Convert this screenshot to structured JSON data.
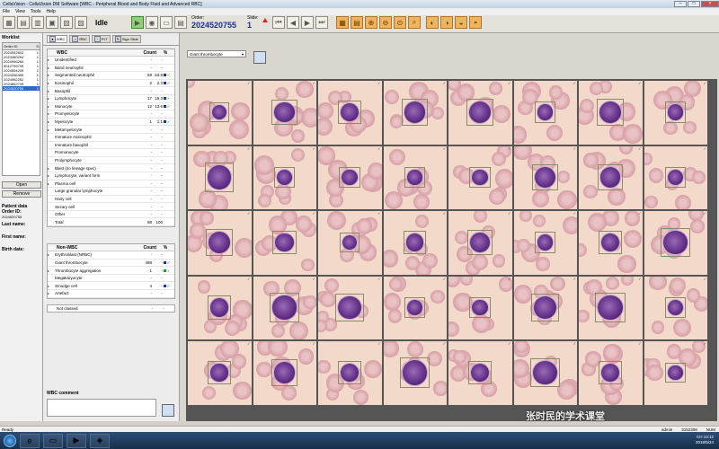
{
  "window": {
    "title": "CellaVision - CellaVision DM Software [WBC - Peripheral Blood and Body Fluid and Advanced RBC]"
  },
  "menu": [
    "File",
    "View",
    "Tools",
    "Help"
  ],
  "toolbar": {
    "status": "Idle",
    "order_label": "Order:",
    "order_value": "2024520755",
    "slide_label": "Slide:",
    "slide_value": "1"
  },
  "worklist": {
    "title": "Worklist",
    "columns": [
      "Order ID",
      "S"
    ],
    "rows": [
      {
        "id": "2024052602",
        "s": "1"
      },
      {
        "id": "2024460294",
        "s": "1"
      },
      {
        "id": "2024946260",
        "s": "1"
      },
      {
        "id": "9012799739",
        "s": "1"
      },
      {
        "id": "2024554209",
        "s": "1"
      },
      {
        "id": "2024346459",
        "s": "1"
      },
      {
        "id": "2024962252",
        "s": "1"
      },
      {
        "id": "2024662749",
        "s": "1"
      },
      {
        "id": "2024520755",
        "s": "1"
      }
    ],
    "open_label": "Open",
    "remove_label": "Remove"
  },
  "patient": {
    "title": "Patient data",
    "order_label": "Order ID:",
    "order_value": "2024520755",
    "last_label": "Last name:",
    "first_label": "First name:",
    "birth_label": "Birth date:"
  },
  "tabs": [
    {
      "label": "WBC"
    },
    {
      "label": "RBC"
    },
    {
      "label": "PLT"
    },
    {
      "label": "Sign Slide"
    }
  ],
  "wbc_table": {
    "header": {
      "name": "WBC",
      "count": "Count",
      "pct": "%"
    },
    "rows": [
      {
        "name": "Unidentified",
        "count": "-",
        "pct": "-",
        "caret": true
      },
      {
        "name": "Band neutrophil",
        "count": "-",
        "pct": "-",
        "caret": true
      },
      {
        "name": "Segmented neutrophil",
        "count": "58",
        "pct": "63.8",
        "caret": true,
        "marker": "blue"
      },
      {
        "name": "Eosinophil",
        "count": "2",
        "pct": "2.3",
        "caret": true,
        "marker": "blue"
      },
      {
        "name": "Basophil",
        "count": "-",
        "pct": "-",
        "caret": true
      },
      {
        "name": "Lymphocyte",
        "count": "17",
        "pct": "19.3",
        "caret": true,
        "marker": "blue"
      },
      {
        "name": "Monocyte",
        "count": "12",
        "pct": "13.6",
        "caret": true,
        "marker": "blue"
      },
      {
        "name": "Promyelocyte",
        "count": "-",
        "pct": "-",
        "caret": true
      },
      {
        "name": "Myelocyte",
        "count": "1",
        "pct": "1.1",
        "caret": true,
        "marker": "blue"
      },
      {
        "name": "Metamyelocyte",
        "count": "-",
        "pct": "-",
        "caret": true
      },
      {
        "name": "Immature eosinophil",
        "count": "-",
        "pct": "-",
        "caret": false
      },
      {
        "name": "Immature basophil",
        "count": "-",
        "pct": "-",
        "caret": false
      },
      {
        "name": "Promonocyte",
        "count": "-",
        "pct": "-",
        "caret": false
      },
      {
        "name": "Prolymphocyte",
        "count": "-",
        "pct": "-",
        "caret": false
      },
      {
        "name": "Blast (no lineage spec)",
        "count": "-",
        "pct": "-",
        "caret": true
      },
      {
        "name": "Lymphocyte, variant form",
        "count": "-",
        "pct": "-",
        "caret": true
      },
      {
        "name": "Plasma cell",
        "count": "-",
        "pct": "-",
        "caret": true
      },
      {
        "name": "Large granular lymphocyte",
        "count": "-",
        "pct": "-",
        "caret": false
      },
      {
        "name": "Hairy cell",
        "count": "-",
        "pct": "-",
        "caret": false
      },
      {
        "name": "Sezary cell",
        "count": "-",
        "pct": "-",
        "caret": false
      },
      {
        "name": "Other",
        "count": "-",
        "pct": "-",
        "caret": false
      },
      {
        "name": "Total",
        "count": "88",
        "pct": "100",
        "caret": false
      }
    ]
  },
  "nonwbc_table": {
    "header": {
      "name": "Non-WBC",
      "count": "Count",
      "pct": "%"
    },
    "rows": [
      {
        "name": "Erythroblast (NRBC)",
        "count": "-",
        "pct": "-",
        "caret": true
      },
      {
        "name": "Giant thrombocyte",
        "count": "498",
        "pct": "-",
        "caret": false,
        "marker": "blue"
      },
      {
        "name": "Thrombocyte aggregation",
        "count": "1",
        "pct": "-",
        "caret": true,
        "marker": "green"
      },
      {
        "name": "Megakaryocyte",
        "count": "-",
        "pct": "-",
        "caret": false
      },
      {
        "name": "Smudge cell",
        "count": "4",
        "pct": "-",
        "caret": true,
        "marker": "blue"
      },
      {
        "name": "Artefact",
        "count": "-",
        "pct": "-",
        "caret": true
      }
    ],
    "not_classed": {
      "name": "Not classed",
      "count": "-",
      "pct": "-"
    }
  },
  "wbc_comment": {
    "title": "WBC comment"
  },
  "gallery": {
    "filter": "Giant thrombocyte"
  },
  "status": {
    "left": "Ready",
    "user": "admin",
    "code": "3152308",
    "mode": "NUM"
  },
  "tray": {
    "time": "13:12",
    "date": "2018/5/24",
    "lang": "CH"
  },
  "watermark": "张时民的学术课堂"
}
